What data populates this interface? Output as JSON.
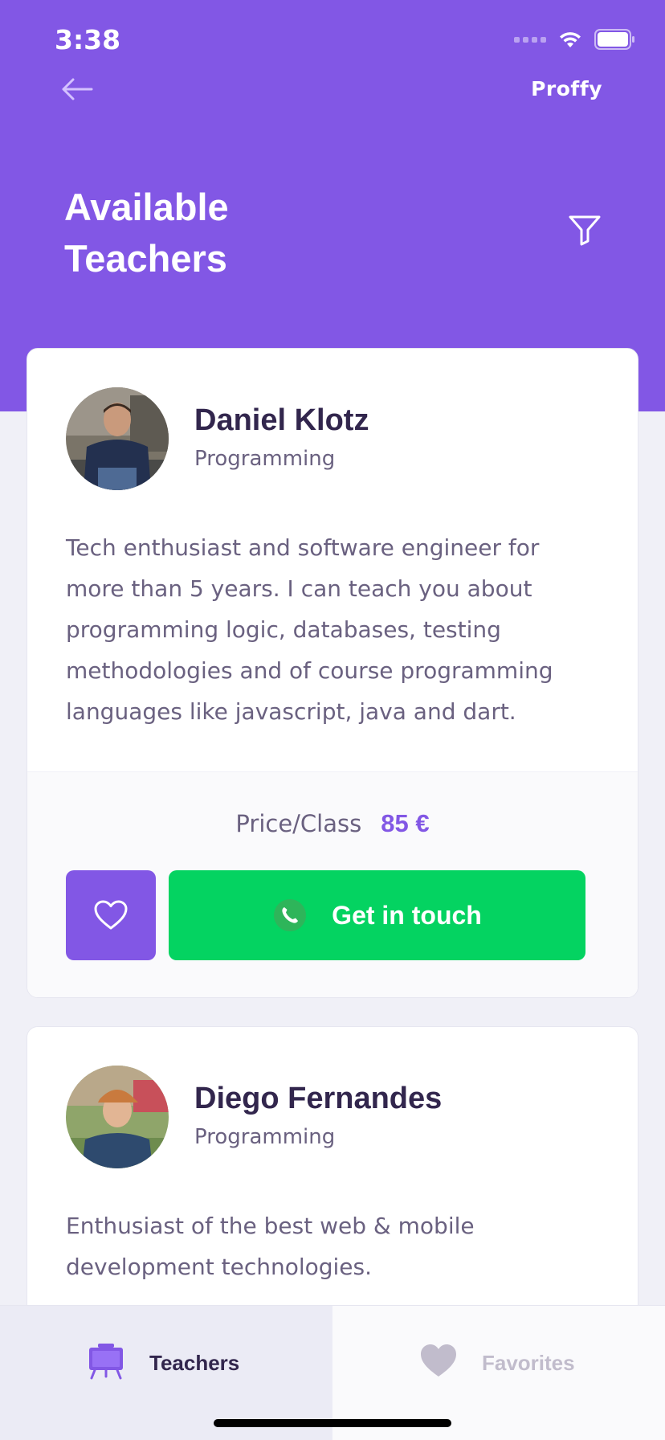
{
  "status_bar": {
    "time": "3:38"
  },
  "header": {
    "brand": "Proffy",
    "title": "Available Teachers"
  },
  "teachers": [
    {
      "name": "Daniel Klotz",
      "subject": "Programming",
      "bio": "Tech enthusiast and software engineer for more than 5 years. I can teach you about programming logic, databases, testing methodologies and of course programming languages like javascript, java and dart.",
      "price_label": "Price/Class",
      "price": "85 €",
      "contact_label": "Get in touch"
    },
    {
      "name": "Diego Fernandes",
      "subject": "Programming",
      "bio": "Enthusiast of the best web & mobile development technologies."
    }
  ],
  "tabs": [
    {
      "label": "Teachers",
      "icon": "easel-icon",
      "active": true
    },
    {
      "label": "Favorites",
      "icon": "heart-icon",
      "active": false
    }
  ],
  "colors": {
    "primary": "#8257E5",
    "success": "#04D361",
    "background": "#F0F0F7",
    "title_text": "#32264D",
    "body_text": "#6A6180",
    "inactive_text": "#C1BCCC"
  }
}
